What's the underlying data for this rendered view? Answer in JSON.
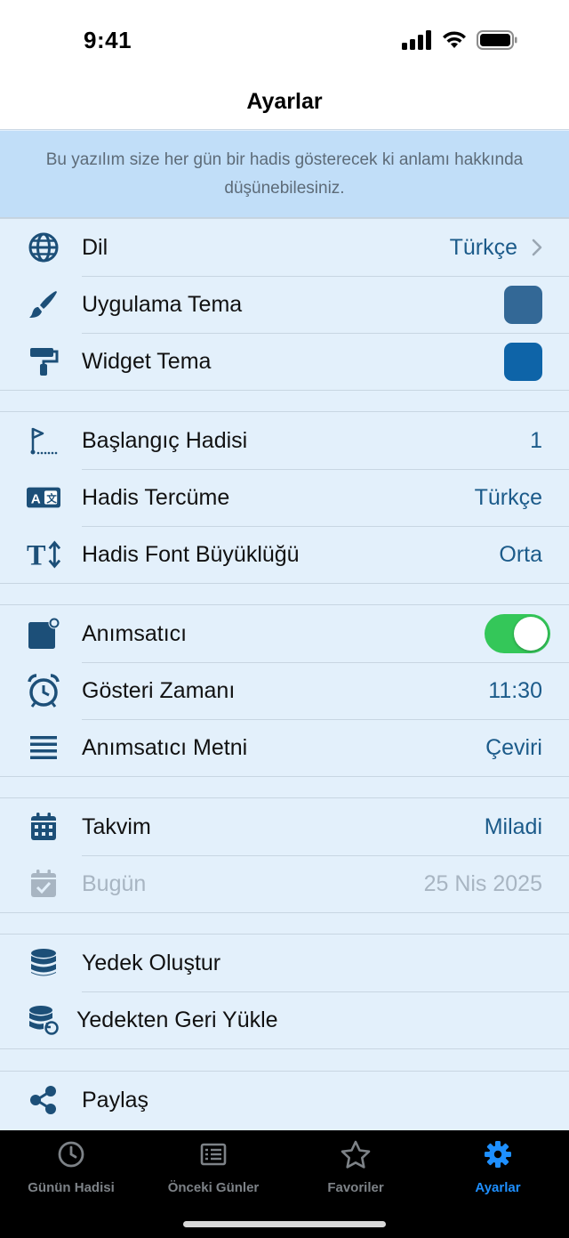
{
  "status_bar": {
    "time": "9:41"
  },
  "nav": {
    "title": "Ayarlar"
  },
  "intro": {
    "text": "Bu yazılım size her gün bir hadis gösterecek ki anlamı hakkında düşünebilesiniz."
  },
  "colors": {
    "app_theme": "#336896",
    "widget_theme": "#0e64a8",
    "icon": "#1c4f78",
    "value": "#1c5b8a",
    "toggle_on": "#34c759",
    "tab_active": "#1e8fff"
  },
  "groups": {
    "appearance": {
      "language": {
        "label": "Dil",
        "value": "Türkçe",
        "icon": "globe-icon"
      },
      "app_theme": {
        "label": "Uygulama Tema",
        "icon": "paintbrush-icon"
      },
      "widget_theme": {
        "label": "Widget Tema",
        "icon": "paint-roller-icon"
      }
    },
    "hadith": {
      "start": {
        "label": "Başlangıç Hadisi",
        "value": "1",
        "icon": "flag-icon"
      },
      "translation": {
        "label": "Hadis Tercüme",
        "value": "Türkçe",
        "icon": "translate-icon"
      },
      "font_size": {
        "label": "Hadis Font Büyüklüğü",
        "value": "Orta",
        "icon": "text-size-icon"
      }
    },
    "reminder": {
      "enabled": {
        "label": "Anımsatıcı",
        "value": true,
        "icon": "notification-badge-icon"
      },
      "time": {
        "label": "Gösteri Zamanı",
        "value": "11:30",
        "icon": "alarm-clock-icon"
      },
      "text": {
        "label": "Anımsatıcı Metni",
        "value": "Çeviri",
        "icon": "lines-icon"
      }
    },
    "calendar": {
      "type": {
        "label": "Takvim",
        "value": "Miladi",
        "icon": "calendar-icon"
      },
      "today": {
        "label": "Bugün",
        "value": "25 Nis 2025",
        "icon": "calendar-check-icon"
      }
    },
    "backup": {
      "create": {
        "label": "Yedek Oluştur",
        "icon": "database-icon"
      },
      "restore": {
        "label": "Yedekten Geri Yükle",
        "icon": "database-restore-icon"
      }
    },
    "share": {
      "share": {
        "label": "Paylaş",
        "icon": "share-icon"
      }
    }
  },
  "tabs": [
    {
      "label": "Günün Hadisi",
      "icon": "clock-icon",
      "active": false
    },
    {
      "label": "Önceki Günler",
      "icon": "list-icon",
      "active": false
    },
    {
      "label": "Favoriler",
      "icon": "star-icon",
      "active": false
    },
    {
      "label": "Ayarlar",
      "icon": "gear-icon",
      "active": true
    }
  ]
}
